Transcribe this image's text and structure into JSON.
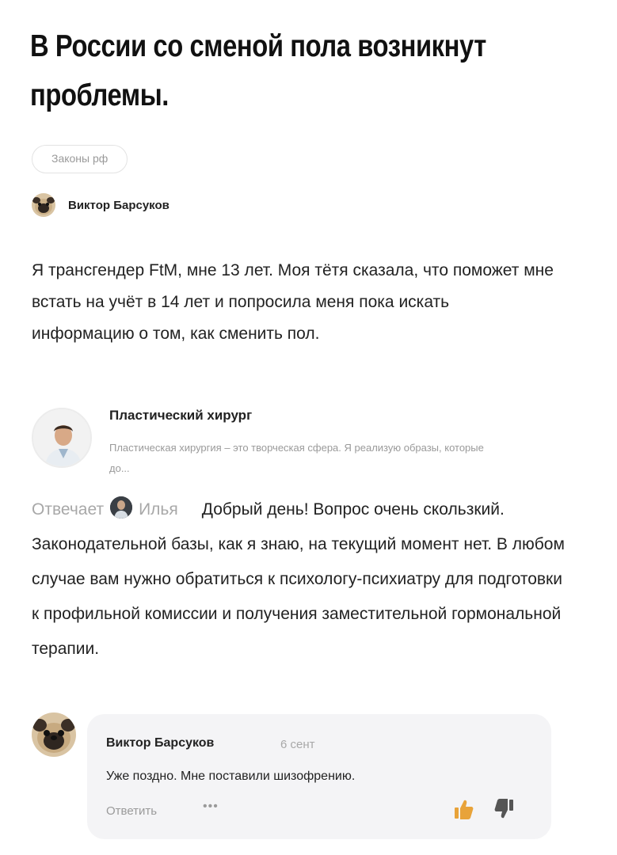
{
  "headline": "В России со сменой пола возникнут проблемы.",
  "tag": {
    "label": "Законы рф"
  },
  "question": {
    "author": "Виктор Барсуков",
    "text": "Я трансгендер FtM, мне 13 лет. Моя тётя сказала, что поможет мне встать на учёт в 14 лет и попросила меня пока искать информацию о том, как сменить пол."
  },
  "expert": {
    "name": "Пластический хирург",
    "description": "Пластическая хирургия – это творческая сфера. Я реализую образы, которые до..."
  },
  "answer": {
    "reply_label": "Отвечает",
    "reply_name": "Илья",
    "text": "Добрый день! Вопрос очень скользкий. Законодательной базы, как я знаю, на текущий момент нет. В любом случае вам нужно обратиться к психологу-психиатру для подготовки к профильной комиссии и получения заместительной гормональной терапии."
  },
  "comment": {
    "author": "Виктор Барсуков",
    "date": "6 сент",
    "text": "Уже поздно. Мне поставили шизофрению.",
    "reply_label": "Ответить",
    "more_label": "•••"
  },
  "icons": {
    "author_avatar": "pug-avatar-icon",
    "expert_avatar": "doctor-avatar-icon",
    "answerer_avatar": "user-avatar-icon",
    "like": "thumbs-up-icon",
    "dislike": "thumbs-down-icon"
  },
  "colors": {
    "text": "#222222",
    "muted": "#9a9a9a",
    "comment_bg": "#f4f4f6",
    "like": "#e8a33a"
  }
}
